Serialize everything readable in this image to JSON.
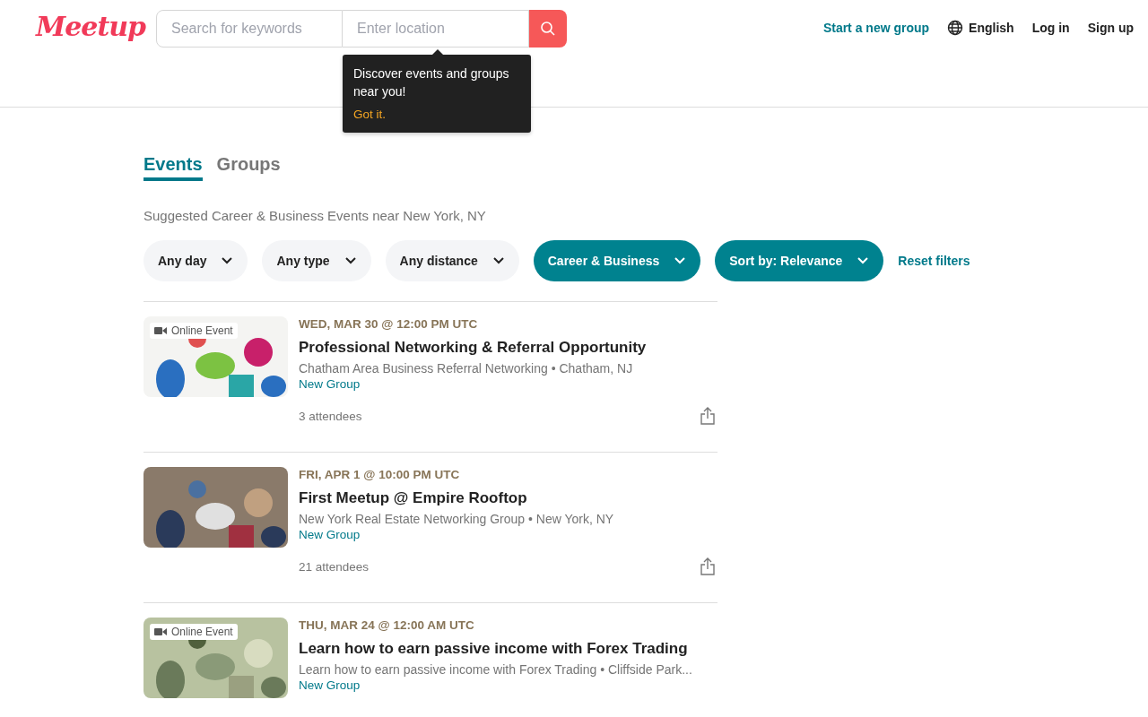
{
  "header": {
    "logo": "Meetup",
    "search": {
      "keywords_placeholder": "Search for keywords",
      "location_placeholder": "Enter location"
    },
    "nav": [
      {
        "label": "Start a new group",
        "kind": "accent"
      },
      {
        "label": "English",
        "kind": "language"
      },
      {
        "label": "Log in",
        "kind": "plain"
      },
      {
        "label": "Sign up",
        "kind": "plain"
      }
    ],
    "tooltip": {
      "text": "Discover events and groups near you!",
      "action": "Got it."
    }
  },
  "tabs": [
    {
      "label": "Events",
      "selected": true
    },
    {
      "label": "Groups",
      "selected": false
    }
  ],
  "subtitle": "Suggested Career & Business Events near New York, NY",
  "filters": [
    {
      "label": "Any day",
      "active": false
    },
    {
      "label": "Any type",
      "active": false
    },
    {
      "label": "Any distance",
      "active": false
    },
    {
      "label": "Career & Business",
      "active": true
    },
    {
      "label": "Sort by: Relevance",
      "active": true
    }
  ],
  "reset": "Reset filters",
  "events": [
    {
      "date": "WED, MAR 30 @ 12:00 PM UTC",
      "title": "Professional Networking & Referral Opportunity",
      "group": "Chatham Area Business Referral Networking • Chatham, NJ",
      "tag": "New Group",
      "attendees": "3 attendees",
      "online": true,
      "badge": "Online Event"
    },
    {
      "date": "FRI, APR 1 @ 10:00 PM UTC",
      "title": "First Meetup @ Empire Rooftop",
      "group": "New York Real Estate Networking Group • New York, NY",
      "tag": "New Group",
      "attendees": "21 attendees",
      "online": false
    },
    {
      "date": "THU, MAR 24 @ 12:00 AM UTC",
      "title": "Learn how to earn passive income with Forex Trading",
      "group": "Learn how to earn passive income with Forex Trading • Cliffside Park...",
      "tag": "New Group",
      "online": true,
      "badge": "Online Event"
    }
  ]
}
